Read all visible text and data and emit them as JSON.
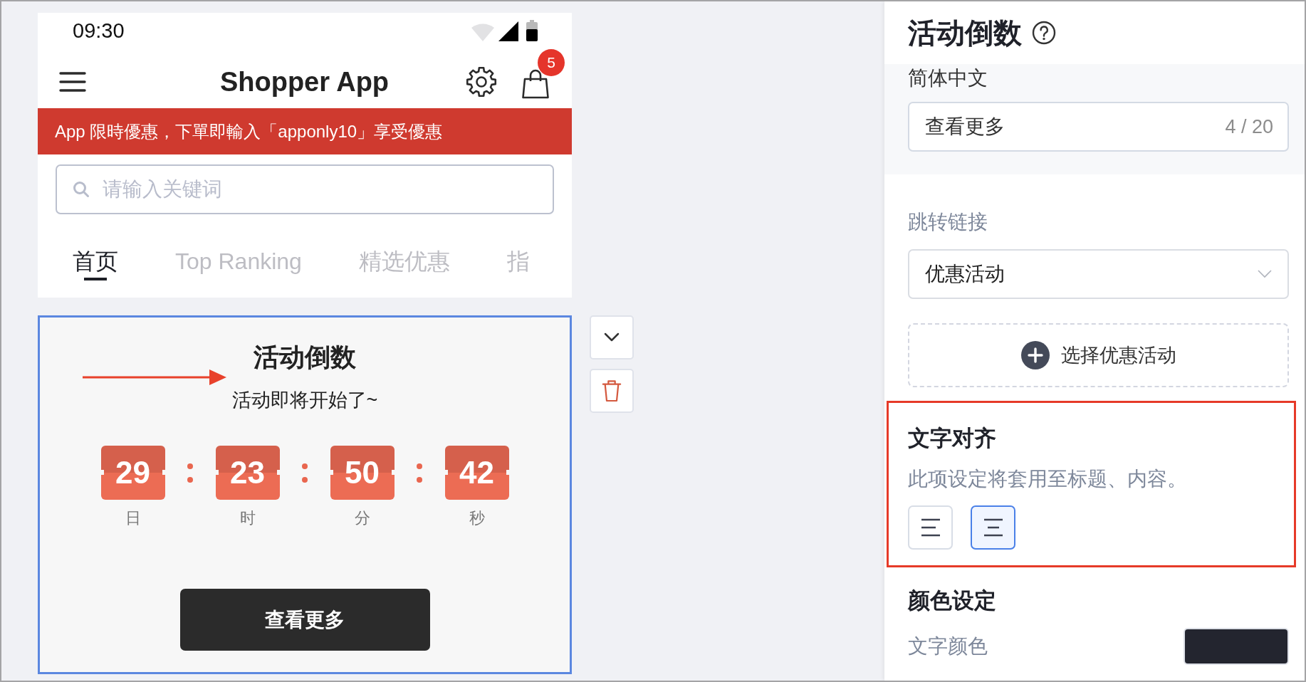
{
  "status_bar": {
    "time": "09:30"
  },
  "app_header": {
    "title": "Shopper App",
    "cart_badge": "5"
  },
  "promo_banner": {
    "text": "App 限時優惠，下單即輸入「apponly10」享受優惠"
  },
  "search": {
    "placeholder": "请输入关键词"
  },
  "tabs": [
    {
      "label": "首页",
      "selected": true
    },
    {
      "label": "Top Ranking",
      "selected": false
    },
    {
      "label": "精选优惠",
      "selected": false
    },
    {
      "label": "指",
      "selected": false
    }
  ],
  "countdown_card": {
    "selected": true,
    "title": "活动倒数",
    "subtitle": "活动即将开始了~",
    "units": [
      {
        "value": "29",
        "label": "日"
      },
      {
        "value": "23",
        "label": "时"
      },
      {
        "value": "50",
        "label": "分"
      },
      {
        "value": "42",
        "label": "秒"
      }
    ],
    "button": "查看更多",
    "annotations": [
      {
        "kind": "arrow"
      }
    ]
  },
  "settings_panel": {
    "title": "活动倒数",
    "language_section": {
      "label": "简体中文",
      "button_text": {
        "value": "查看更多",
        "counter": "4 / 20"
      }
    },
    "link": {
      "label": "跳转链接",
      "value": "优惠活动"
    },
    "add_button": "选择优惠活动",
    "text_align": {
      "highlighted": true,
      "title": "文字对齐",
      "description": "此项设定将套用至标题、内容。",
      "options": [
        {
          "kind": "left",
          "selected": false
        },
        {
          "kind": "center",
          "selected": true
        }
      ]
    },
    "color_settings": {
      "title": "颜色设定",
      "rows": [
        {
          "label": "文字颜色",
          "color": "#23252f"
        }
      ]
    }
  }
}
